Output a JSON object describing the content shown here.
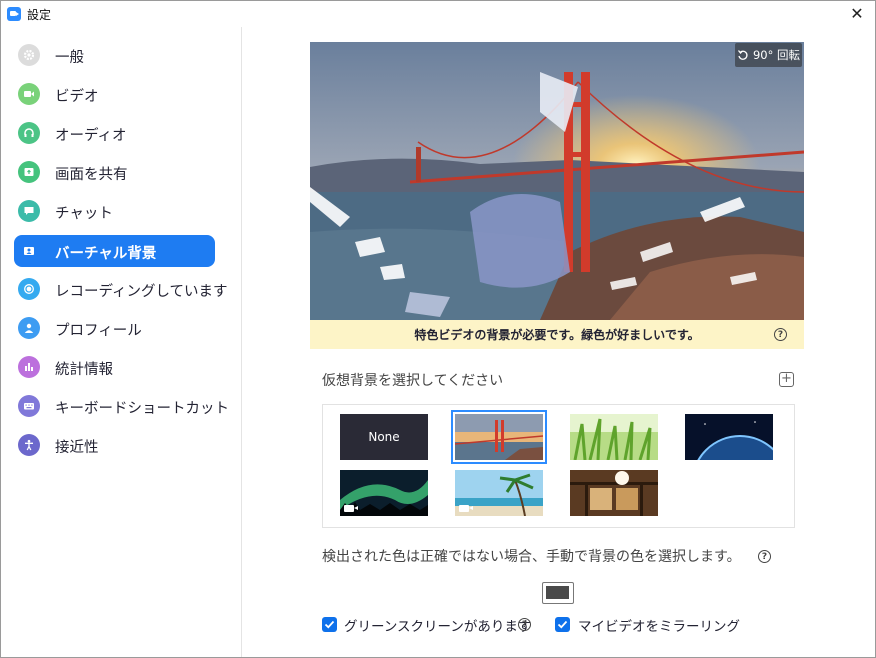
{
  "window": {
    "title": "設定",
    "close_glyph": "✕"
  },
  "sidebar": {
    "items": [
      {
        "label": "一般",
        "icon": "gear-icon",
        "color": "#d9d9d9"
      },
      {
        "label": "ビデオ",
        "icon": "video-icon",
        "color": "#6dcd6d"
      },
      {
        "label": "オーディオ",
        "icon": "headphones-icon",
        "color": "#3fbf7f"
      },
      {
        "label": "画面を共有",
        "icon": "share-screen-icon",
        "color": "#40c27a"
      },
      {
        "label": "チャット",
        "icon": "chat-icon",
        "color": "#35b8a6"
      },
      {
        "label": "バーチャル背景",
        "icon": "virtual-background-icon",
        "color": "#1e7cf2",
        "active": true
      },
      {
        "label": "レコーディングしています",
        "icon": "record-icon",
        "color": "#2ea7f0"
      },
      {
        "label": "プロフィール",
        "icon": "profile-icon",
        "color": "#3a9af2"
      },
      {
        "label": "統計情報",
        "icon": "statistics-icon",
        "color": "#b96cdc"
      },
      {
        "label": "キーボードショートカット",
        "icon": "keyboard-icon",
        "color": "#7d78d8"
      },
      {
        "label": "接近性",
        "icon": "accessibility-icon",
        "color": "#6a66cc"
      }
    ]
  },
  "preview": {
    "rotate_label": "90° 回転",
    "notice": "特色ビデオの背景が必要です。緑色が好ましいです。",
    "help_glyph": "?"
  },
  "backgrounds": {
    "title": "仮想背景を選択してください",
    "add_glyph": "+",
    "items": [
      {
        "name": "none",
        "label": "None"
      },
      {
        "name": "golden-gate-bridge",
        "selected": true
      },
      {
        "name": "grass"
      },
      {
        "name": "earth-from-space"
      },
      {
        "name": "aurora",
        "video": true
      },
      {
        "name": "beach-palm",
        "video": true
      },
      {
        "name": "japanese-room"
      }
    ]
  },
  "detection": {
    "text": "検出された色は正確ではない場合、手動で背景の色を選択します。",
    "help_glyph": "?",
    "swatch_color": "#4a4a4a"
  },
  "options": {
    "green_screen_label": "グリーンスクリーンがあります",
    "green_screen_checked": true,
    "green_screen_help": "?",
    "mirror_label": "マイビデオをミラーリング",
    "mirror_checked": true
  }
}
